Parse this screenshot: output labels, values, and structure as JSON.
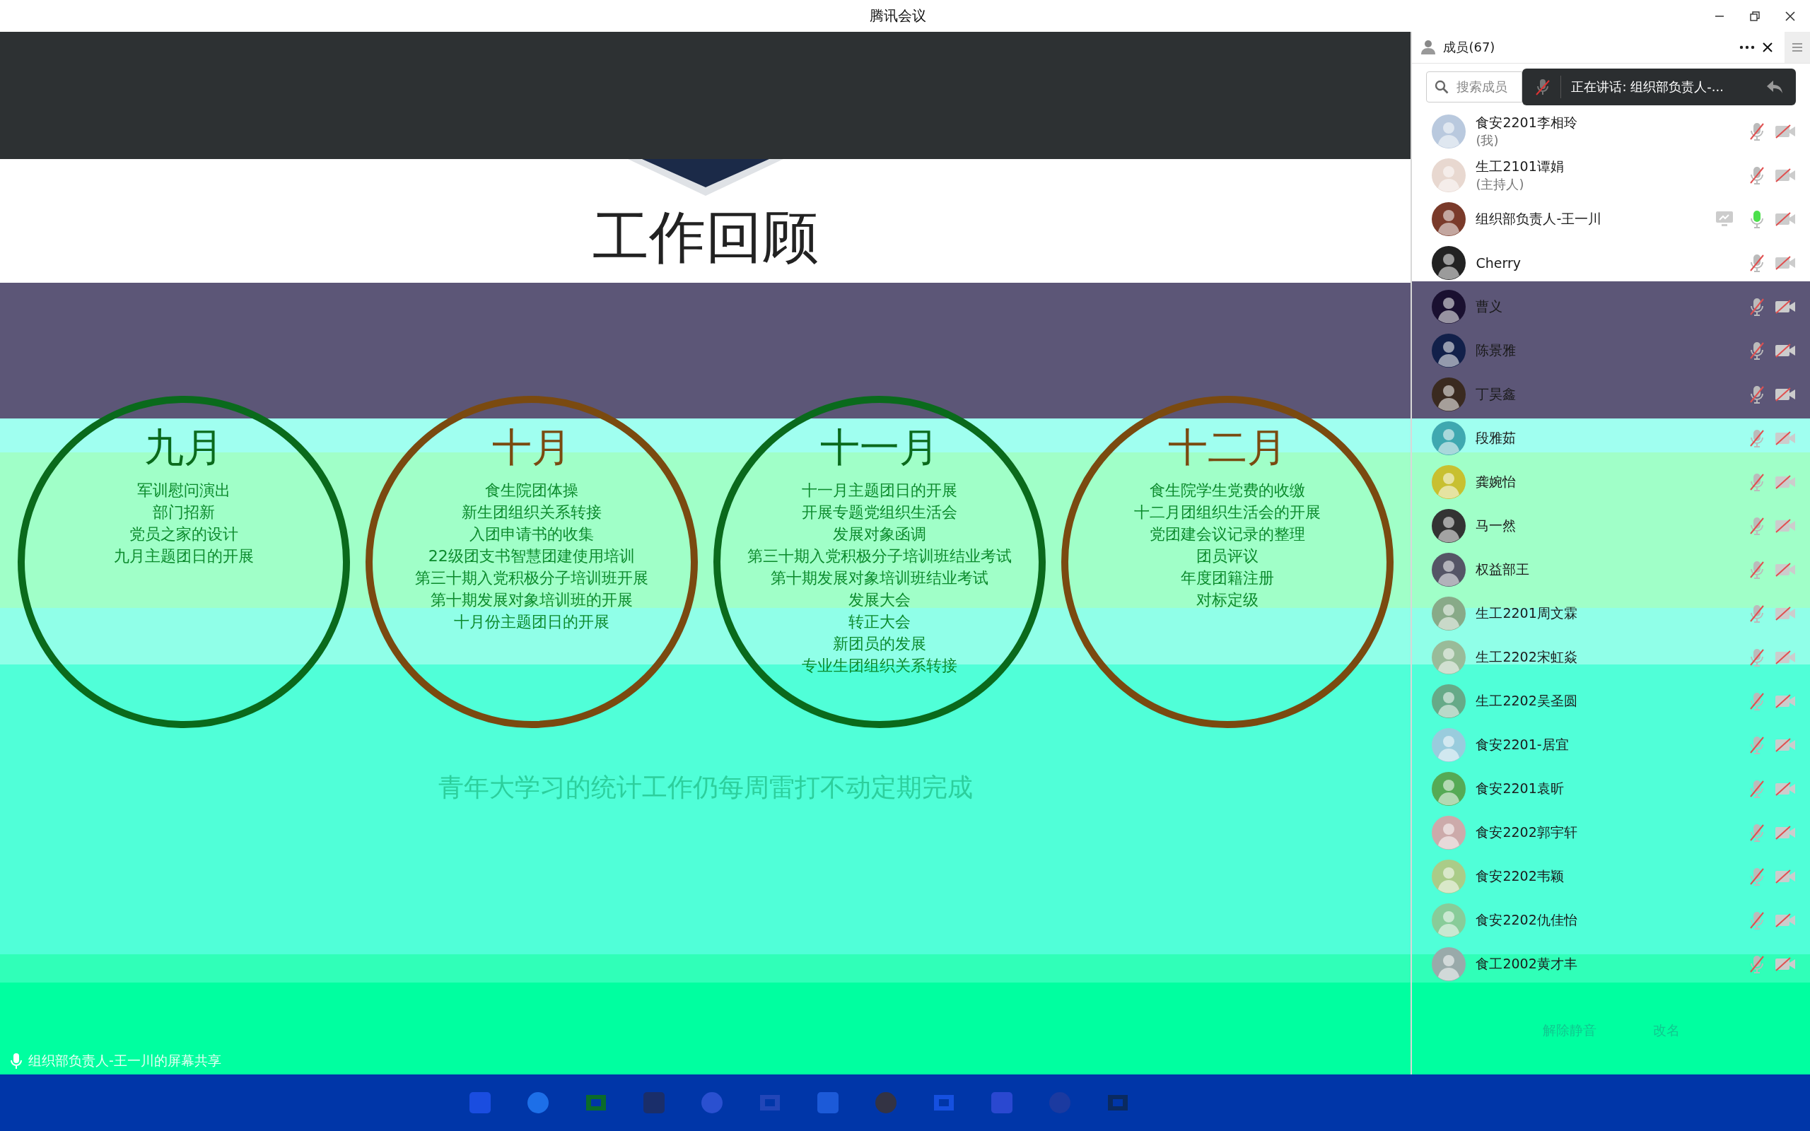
{
  "window": {
    "title": "腾讯会议"
  },
  "slide": {
    "title": "工作回顾",
    "months": [
      {
        "title": "九月",
        "color": "#0a6a1c",
        "items": [
          "军训慰问演出",
          "部门招新",
          "党员之家的设计",
          "九月主题团日的开展"
        ]
      },
      {
        "title": "十月",
        "color": "#7a4a10",
        "items": [
          "食生院团体操",
          "新生团组织关系转接",
          "入团申请书的收集",
          "22级团支书智慧团建使用培训",
          "第三十期入党积极分子培训班开展",
          "第十期发展对象培训班的开展",
          "十月份主题团日的开展"
        ]
      },
      {
        "title": "十一月",
        "color": "#0a6a1c",
        "items": [
          "十一月主题团日的开展",
          "开展专题党组织生活会",
          "发展对象函调",
          "第三十期入党积极分子培训班结业考试",
          "第十期发展对象培训班结业考试",
          "发展大会",
          "转正大会",
          "新团员的发展",
          "专业生团组织关系转接"
        ]
      },
      {
        "title": "十二月",
        "color": "#7a4a10",
        "items": [
          "食生院学生党费的收缴",
          "十二月团组织生活会的开展",
          "党团建会议记录的整理",
          "团员评议",
          "年度团籍注册",
          "对标定级"
        ]
      }
    ],
    "footer": "青年大学习的统计工作仍每周雷打不动定期完成"
  },
  "share_label": "组织部负责人-王一川的屏幕共享",
  "members_panel": {
    "title": "成员(67)",
    "search": {
      "placeholder": "搜索成员"
    },
    "speaking_toast": "正在讲话: 组织部负责人-...",
    "members": [
      {
        "name": "食安2201李相玲",
        "note": "(我)",
        "muted": true,
        "camera_on": false,
        "sharing": false
      },
      {
        "name": "生工2101谭娟",
        "note": "(主持人)",
        "muted": true,
        "camera_on": false,
        "sharing": false
      },
      {
        "name": "组织部负责人-王一川",
        "muted": false,
        "camera_on": false,
        "sharing": true
      },
      {
        "name": "Cherry",
        "muted": true,
        "camera_on": false,
        "sharing": false
      },
      {
        "name": "曹义",
        "muted": true,
        "camera_on": false,
        "sharing": false
      },
      {
        "name": "陈景雅",
        "muted": true,
        "camera_on": false,
        "sharing": false
      },
      {
        "name": "丁昊鑫",
        "muted": true,
        "camera_on": false,
        "sharing": false
      },
      {
        "name": "段雅茹",
        "muted": true,
        "camera_on": false,
        "sharing": false
      },
      {
        "name": "龚婉怡",
        "muted": true,
        "camera_on": false,
        "sharing": false
      },
      {
        "name": "马一然",
        "muted": true,
        "camera_on": false,
        "sharing": false
      },
      {
        "name": "权益部王",
        "muted": true,
        "camera_on": false,
        "sharing": false
      },
      {
        "name": "生工2201周文霖",
        "muted": true,
        "camera_on": false,
        "sharing": false
      },
      {
        "name": "生工2202宋虹焱",
        "muted": true,
        "camera_on": false,
        "sharing": false
      },
      {
        "name": "生工2202吴圣圆",
        "muted": true,
        "camera_on": false,
        "sharing": false
      },
      {
        "name": "食安2201-居宜",
        "muted": true,
        "camera_on": false,
        "sharing": false
      },
      {
        "name": "食安2201袁昕",
        "muted": true,
        "camera_on": false,
        "sharing": false
      },
      {
        "name": "食安2202郭宇轩",
        "muted": true,
        "camera_on": false,
        "sharing": false
      },
      {
        "name": "食安2202韦颖",
        "muted": true,
        "camera_on": false,
        "sharing": false
      },
      {
        "name": "食安2202仇佳怡",
        "muted": true,
        "camera_on": false,
        "sharing": false
      },
      {
        "name": "食工2002黄才丰",
        "muted": true,
        "camera_on": false,
        "sharing": false
      }
    ],
    "actions": [
      "解除静音",
      "改名"
    ]
  }
}
